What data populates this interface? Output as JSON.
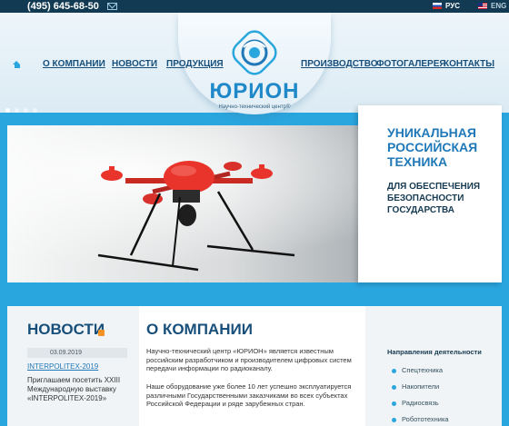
{
  "topbar": {
    "phone": "(495) 645-68-50",
    "lang_ru": "РУС",
    "lang_en": "ENG"
  },
  "nav": {
    "items": [
      "О КОМПАНИИ",
      "НОВОСТИ",
      "ПРОДУКЦИЯ",
      "ПРОИЗВОДСТВО",
      "ФОТОГАЛЕРЕЯ",
      "КОНТАКТЫ"
    ]
  },
  "logo": {
    "brand": "ЮРИОН",
    "tagline": "Научно-технический центр®"
  },
  "slide": {
    "title": "УНИКАЛЬНАЯ РОССИЙСКАЯ ТЕХНИКА",
    "subtitle": "ДЛЯ ОБЕСПЕЧЕНИЯ БЕЗОПАСНОСТИ ГОСУДАРСТВА"
  },
  "news": {
    "heading": "НОВОСТИ",
    "date": "03.09.2019",
    "link": "INTERPOLITEX-2019",
    "text": "Приглашаем посетить XXIII Международную выставку «INTERPOLITEX-2019»"
  },
  "about": {
    "heading": "О КОМПАНИИ",
    "p1": "Научно-технический центр «ЮРИОН» является известным российским разработчиком и производителем цифровых систем передачи информации по радиоканалу.",
    "p2": "Наше оборудование уже более 10 лет успешно эксплуатируется различными Государственными заказчиками во всех субъектах Российской Федерации и ряде зарубежных стран."
  },
  "sidebar": {
    "heading": "Направления деятельности",
    "items": [
      "Спецтехника",
      "Накопители",
      "Радиосвязь",
      "Робототехника"
    ]
  },
  "colors": {
    "accent": "#2aa6df",
    "nav_text": "#174f7a",
    "topbar": "#123b53",
    "drone_red": "#e8342a"
  },
  "icons": [
    "mail-icon",
    "home-icon",
    "rss-icon",
    "flag-ru-icon",
    "flag-en-icon"
  ]
}
